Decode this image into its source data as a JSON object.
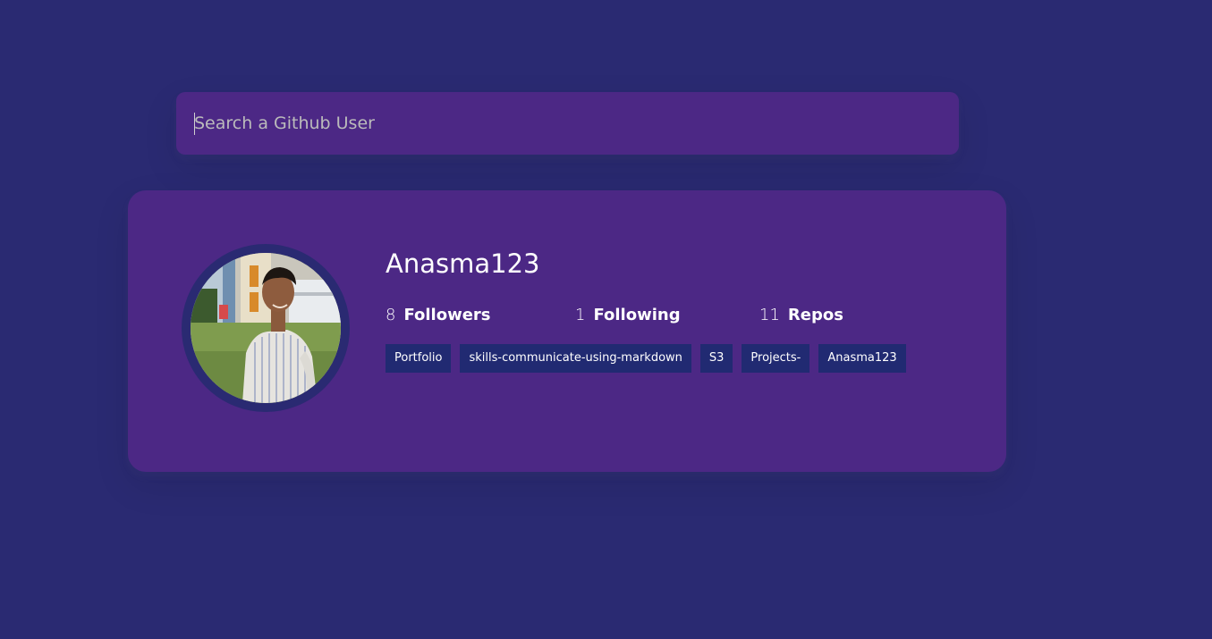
{
  "search": {
    "placeholder": "Search a Github User",
    "value": ""
  },
  "profile": {
    "username": "Anasma123",
    "stats": {
      "followers": {
        "count": "8",
        "label": "Followers"
      },
      "following": {
        "count": "1",
        "label": "Following"
      },
      "repos": {
        "count": "11",
        "label": "Repos"
      }
    },
    "repos": [
      "Portfolio",
      "skills-communicate-using-markdown",
      "S3",
      "Projects-",
      "Anasma123"
    ]
  },
  "colors": {
    "page_background": "#2a2a72",
    "card_background": "#4c2885",
    "repo_tag_background": "#212a72",
    "text": "#ffffff"
  }
}
